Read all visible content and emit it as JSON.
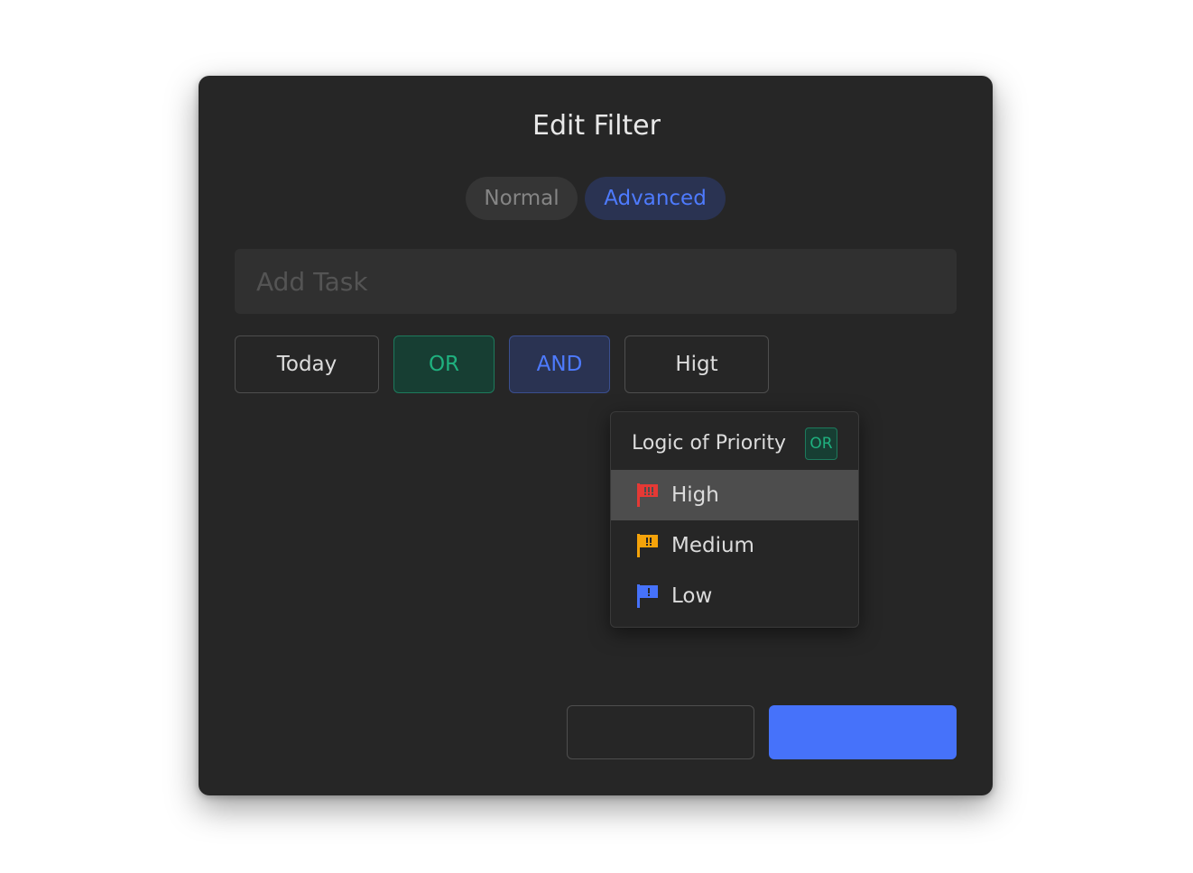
{
  "dialog": {
    "title": "Edit Filter",
    "mode_tabs": [
      {
        "label": "Normal",
        "active": false
      },
      {
        "label": "Advanced",
        "active": true
      }
    ],
    "task_input": {
      "value": "",
      "placeholder": "Add Task"
    },
    "chips": [
      {
        "label": "Today"
      },
      {
        "label": "OR"
      },
      {
        "label": "AND"
      },
      {
        "label": "Higt"
      }
    ],
    "priority_dropdown": {
      "header_label": "Logic of Priority",
      "logic_badge": "OR",
      "items": [
        {
          "label": "High",
          "icon": "flag-icon",
          "color": "#e53935",
          "selected": true
        },
        {
          "label": "Medium",
          "icon": "flag-icon",
          "color": "#f5a30a",
          "selected": false
        },
        {
          "label": "Low",
          "icon": "flag-icon",
          "color": "#4672fa",
          "selected": false
        }
      ]
    },
    "footer": {
      "cancel_label": "",
      "confirm_label": ""
    }
  },
  "colors": {
    "background": "#262626",
    "accent_blue": "#4672fa",
    "accent_green": "#1fb17f",
    "priority_high": "#e53935",
    "priority_medium": "#f5a30a",
    "priority_low": "#4672fa"
  }
}
